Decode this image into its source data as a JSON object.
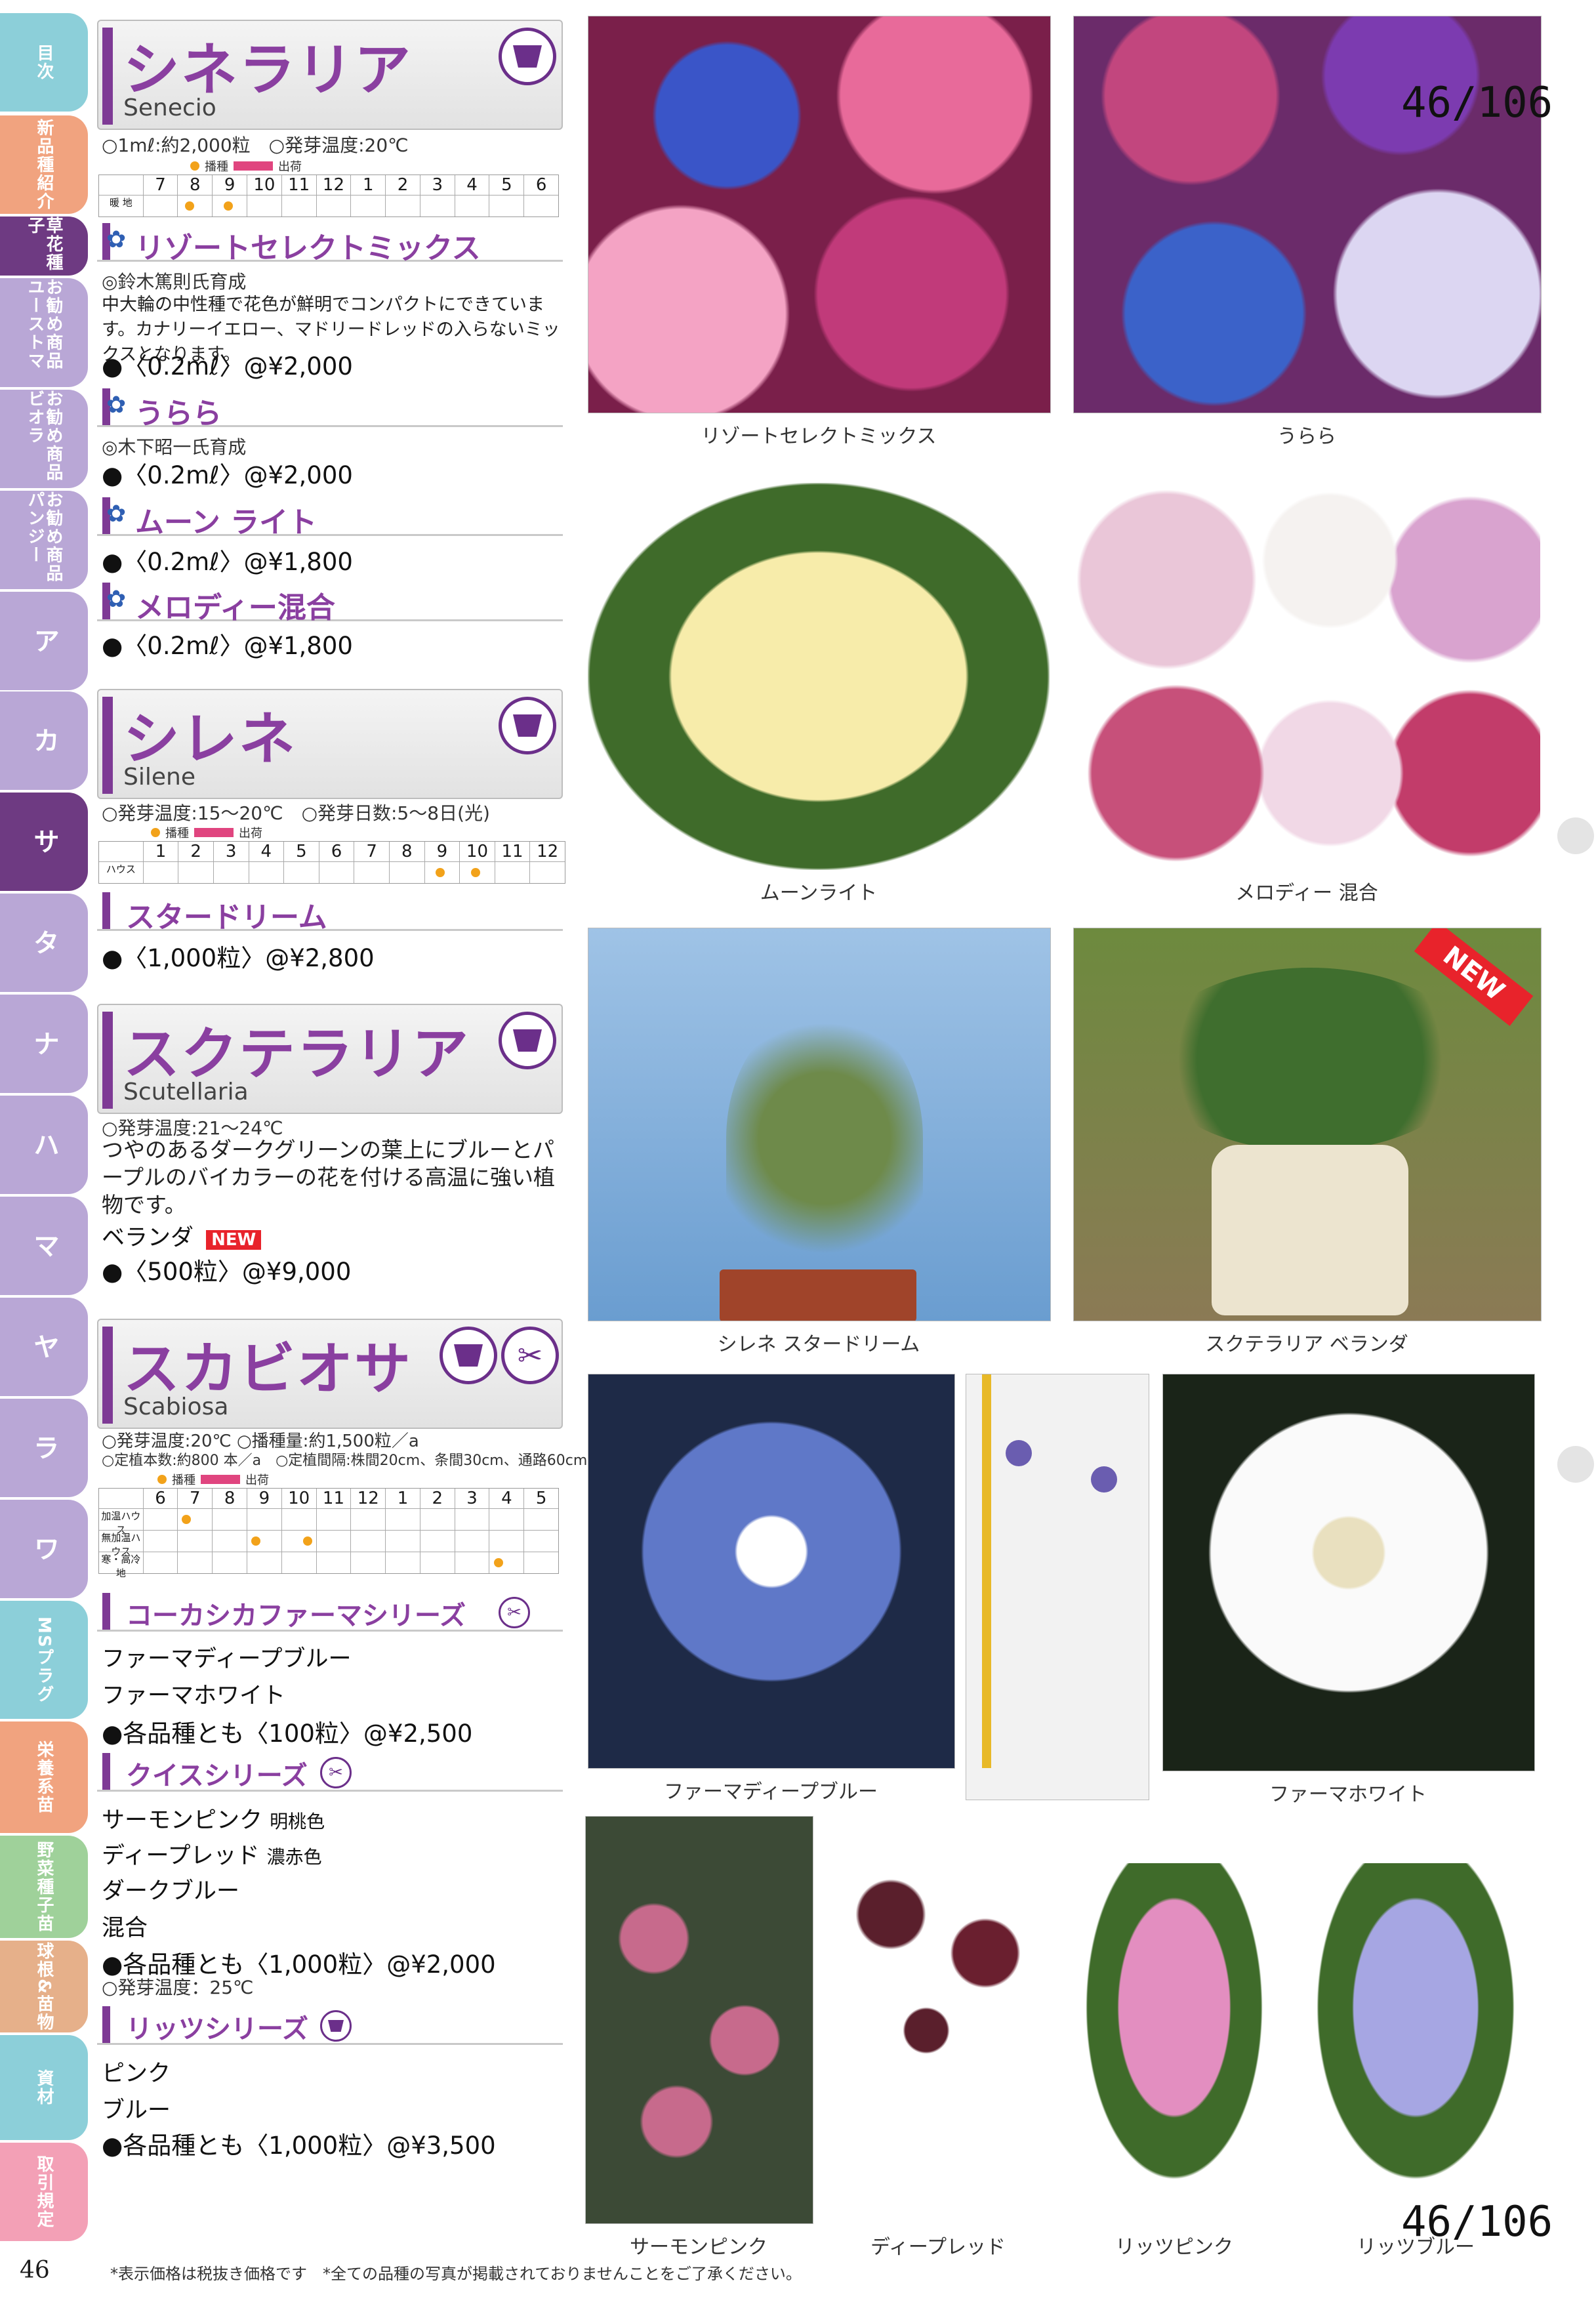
{
  "tabs": [
    {
      "label": "目次",
      "color": "#8ccfd9"
    },
    {
      "label": "新品種紹介",
      "color": "#f1a37f"
    },
    {
      "label": "草花種子",
      "color": "#6e3a82"
    },
    {
      "label": "お勧め商品ユーストマ",
      "color": "#b9a7d6"
    },
    {
      "label": "お勧め商品ビオラ",
      "color": "#b9a7d6"
    },
    {
      "label": "お勧め商品パンジー",
      "color": "#b9a7d6"
    },
    {
      "label": "ア",
      "color": "#b9a7d6"
    },
    {
      "label": "カ",
      "color": "#b9a7d6"
    },
    {
      "label": "サ",
      "color": "#6e3a82"
    },
    {
      "label": "タ",
      "color": "#b9a7d6"
    },
    {
      "label": "ナ",
      "color": "#b9a7d6"
    },
    {
      "label": "ハ",
      "color": "#b9a7d6"
    },
    {
      "label": "マ",
      "color": "#b9a7d6"
    },
    {
      "label": "ヤ",
      "color": "#b9a7d6"
    },
    {
      "label": "ラ",
      "color": "#b9a7d6"
    },
    {
      "label": "ワ",
      "color": "#b9a7d6"
    },
    {
      "label": "MSプラグ",
      "color": "#8ccfd9"
    },
    {
      "label": "栄養系苗",
      "color": "#f1a37f"
    },
    {
      "label": "野菜種子苗",
      "color": "#9fd19a"
    },
    {
      "label": "球根&苗物",
      "color": "#e6b08a"
    },
    {
      "label": "資材",
      "color": "#8ccfd9"
    },
    {
      "label": "取引規定",
      "color": "#f3a0b6"
    }
  ],
  "page_badge": "46/106",
  "page_number": "46",
  "footnote": "*表示価格は税抜き価格です　*全ての品種の写真が掲載されておりませんことをご了承ください。",
  "cineraria": {
    "name": "シネラリア",
    "latin": "Senecio",
    "note": "○1mℓ:約2,000粒　○発芽温度:20℃",
    "legend_sow": "播種",
    "legend_ship": "出荷",
    "months": [
      "7",
      "8",
      "9",
      "10",
      "11",
      "12",
      "1",
      "2",
      "3",
      "4",
      "5",
      "6"
    ],
    "row_label": "暖 地",
    "varieties": [
      {
        "name": "リゾートセレクトミックス",
        "breeder": "◎鈴木篤則氏育成",
        "desc": "中大輪の中性種で花色が鮮明でコンパクトにできています。カナリーイエロー、マドリードレッドの入らないミックスとなります。",
        "price": "●〈0.2mℓ〉@¥2,000"
      },
      {
        "name": "うらら",
        "breeder": "◎木下昭一氏育成",
        "price": "●〈0.2mℓ〉@¥2,000"
      },
      {
        "name": "ムーン ライト",
        "price": "●〈0.2mℓ〉@¥1,800"
      },
      {
        "name": "メロディー混合",
        "price": "●〈0.2mℓ〉@¥1,800"
      }
    ]
  },
  "silene": {
    "name": "シレネ",
    "latin": "Silene",
    "note": "○発芽温度:15～20℃　○発芽日数:5～8日(光)",
    "months": [
      "1",
      "2",
      "3",
      "4",
      "5",
      "6",
      "7",
      "8",
      "9",
      "10",
      "11",
      "12"
    ],
    "row_label": "ハウス",
    "variety": "スタードリーム",
    "price": "●〈1,000粒〉@¥2,800"
  },
  "scutellaria": {
    "name": "スクテラリア",
    "latin": "Scutellaria",
    "note": "○発芽温度:21～24℃",
    "desc": "つやのあるダークグリーンの葉上にブルーとパープルのバイカラーの花を付ける高温に強い植物です。",
    "variety": "ベランダ",
    "new": "NEW",
    "price": "●〈500粒〉@¥9,000"
  },
  "scabiosa": {
    "name": "スカビオサ",
    "latin": "Scabiosa",
    "note1": "○発芽温度:20℃ ○播種量:約1,500粒／a",
    "note2": "○定植本数:約800 本／a　○定植間隔:株間20cm、条間30cm、通路60cm",
    "months": [
      "6",
      "7",
      "8",
      "9",
      "10",
      "11",
      "12",
      "1",
      "2",
      "3",
      "4",
      "5"
    ],
    "rows": [
      "加温ハウス",
      "無加温ハウス",
      "寒・高冷地"
    ],
    "series1": {
      "name": "コーカシカファーマシリーズ",
      "items": [
        "ファーマディープブルー",
        "ファーマホワイト"
      ],
      "price": "●各品種とも〈100粒〉@¥2,500"
    },
    "series2": {
      "name": "クイスシリーズ",
      "items": [
        {
          "name": "サーモンピンク",
          "sub": "明桃色"
        },
        {
          "name": "ディープレッド",
          "sub": "濃赤色"
        },
        {
          "name": "ダークブルー",
          "sub": ""
        },
        {
          "name": "混合",
          "sub": ""
        }
      ],
      "price": "●各品種とも〈1,000粒〉@¥2,000",
      "note": "○発芽温度：25℃"
    },
    "series3": {
      "name": "リッツシリーズ",
      "items": [
        "ピンク",
        "ブルー"
      ],
      "price": "●各品種とも〈1,000粒〉@¥3,500"
    }
  },
  "captions": {
    "c1": "リゾートセレクトミックス",
    "c2": "うらら",
    "c3": "ムーンライト",
    "c4": "メロディー 混合",
    "c5": "シレネ スタードリーム",
    "c6": "スクテラリア ベランダ",
    "c7": "ファーマディープブルー",
    "c8": "ファーマホワイト",
    "c9": "サーモンピンク",
    "c10": "ディープレッド",
    "c11": "リッツピンク",
    "c12": "リッツブルー"
  },
  "new_badge": "NEW",
  "icon_names": [
    "pot-icon",
    "scissors-icon",
    "flower-icon"
  ]
}
